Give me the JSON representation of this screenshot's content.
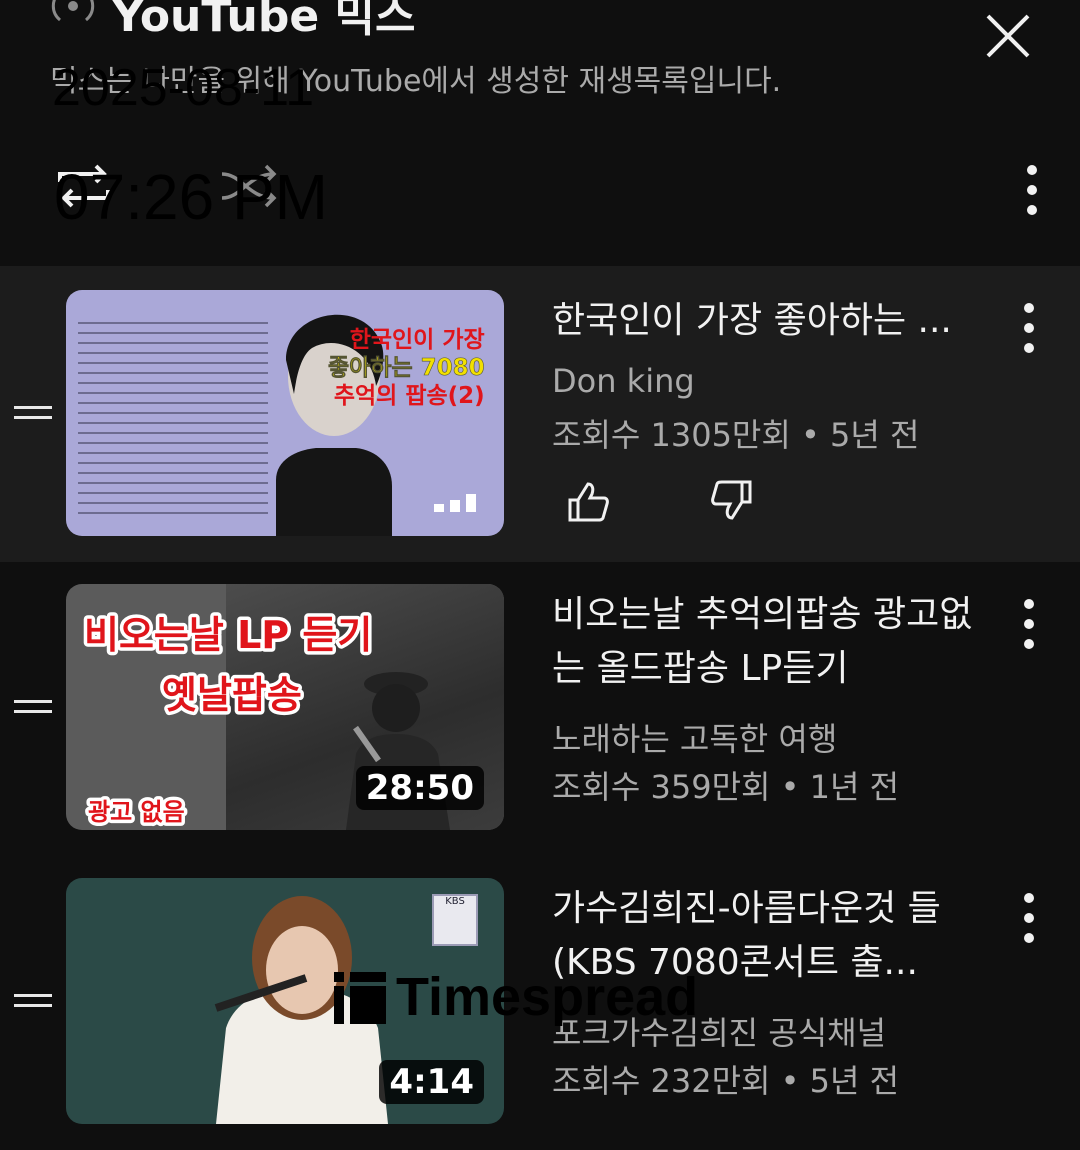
{
  "header": {
    "title": "YouTube 믹스",
    "subtitle": "믹스는 나만을 위해 YouTube에서 생성한 재생목록입니다.",
    "icons": {
      "radio": "radio-icon",
      "close": "close-icon",
      "repeat": "repeat-icon",
      "shuffle": "shuffle-icon",
      "more": "more-vert-icon"
    }
  },
  "overlay": {
    "date": "2025-08-11",
    "time": "07:26 PM"
  },
  "items": [
    {
      "title": "한국인이 가장 좋아하는 ...",
      "channel": "Don king",
      "meta": "조회수 1305만회 • 5년 전",
      "thumbnail_caption": [
        "한국인이 가장",
        "좋아하는 7080",
        "추억의 팝송(2)"
      ],
      "playing": true
    },
    {
      "title": "비오는날 추억의팝송 광고없는 올드팝송 LP듣기",
      "channel": "노래하는 고독한 여행",
      "meta": "조회수 359만회 • 1년 전",
      "duration": "28:50",
      "thumbnail_caption": [
        "비오는날 LP 듣기",
        "옛날팝송",
        "광고 없음"
      ]
    },
    {
      "title": "가수김희진-아름다운것 들(KBS 7080콘서트 출...",
      "channel": "포크가수김희진 공식채널",
      "meta": "조회수 232만회 • 5년 전",
      "duration": "4:14",
      "thumbnail_caption": [
        "KBS"
      ]
    }
  ],
  "watermark": "Timespread",
  "colors": {
    "background": "#0f0f0f",
    "current_row": "#1c1c1c",
    "text": "#f1f1f1",
    "secondary": "#aaaaaa"
  }
}
